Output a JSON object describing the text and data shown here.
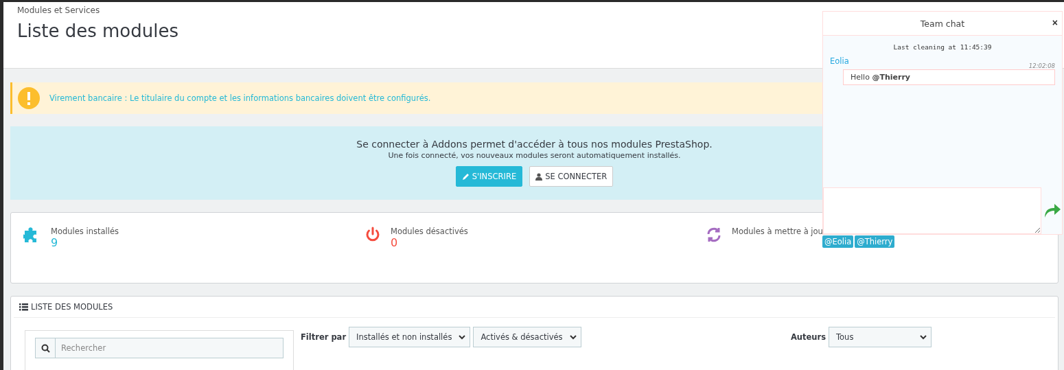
{
  "header": {
    "breadcrumb": "Modules et Services",
    "title": "Liste des modules"
  },
  "alert": {
    "text": "Virement bancaire : Le titulaire du compte et les informations bancaires doivent être configurés."
  },
  "addons": {
    "title": "Se connecter à Addons permet d'accéder à tous nos modules PrestaShop.",
    "subtitle": "Une fois connecté, vos nouveaux modules seront automatiquement installés.",
    "buttons": [
      {
        "label": "S'INSCRIRE",
        "kind": "primary"
      },
      {
        "label": "SE CONNECTER",
        "kind": "default"
      }
    ]
  },
  "stats": [
    {
      "label": "Modules installés",
      "value": "9",
      "kind": "installed",
      "color": "#25b9d7"
    },
    {
      "label": "Modules désactivés",
      "value": "0",
      "kind": "disabled",
      "color": "#f54c3e"
    },
    {
      "label": "Modules à mettre à jou",
      "kind": "update",
      "color": "#a56cc1"
    }
  ],
  "module_list": {
    "title": "LISTE DES MODULES",
    "search": {
      "placeholder": "Rechercher"
    },
    "filter_label": "Filtrer par",
    "filters": [
      "Installés et non installés",
      "Activés & désactivés"
    ],
    "authors_label": "Auteurs",
    "authors": "Tous"
  },
  "chat": {
    "title": "Team chat",
    "close": "×",
    "notice": "Last cleaning at 11:45:39",
    "messages": [
      {
        "author": "Eolia",
        "time": "12:02:08",
        "text": "Hello **@Thierry**"
      }
    ],
    "mentions": [
      "@Eolia",
      "@Thierry"
    ]
  }
}
